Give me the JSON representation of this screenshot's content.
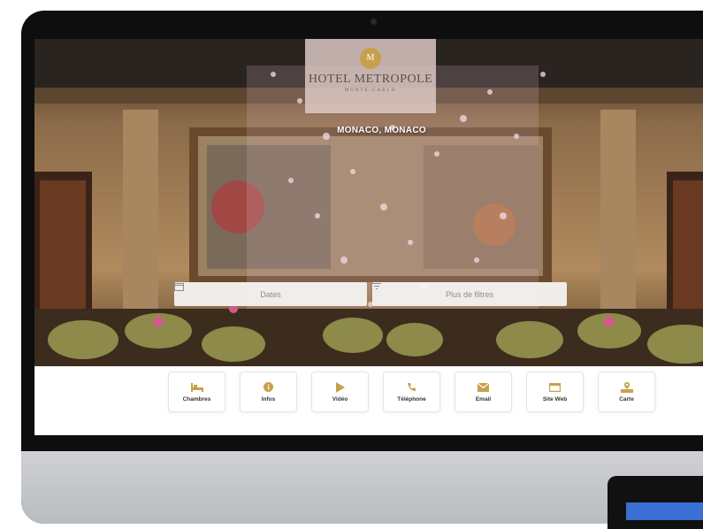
{
  "hotel": {
    "logo_mark": "M",
    "name": "HOTEL METROPOLE",
    "tagline": "MONTE-CARLO",
    "location": "MONACO, MONACO"
  },
  "search": {
    "dates_label": "Dates",
    "filters_label": "Plus de filtres"
  },
  "actions": [
    {
      "label": "Chambres",
      "icon": "bed-icon"
    },
    {
      "label": "Infos",
      "icon": "info-icon"
    },
    {
      "label": "Vidéo",
      "icon": "play-icon"
    },
    {
      "label": "Téléphone",
      "icon": "phone-icon"
    },
    {
      "label": "Email",
      "icon": "email-icon"
    },
    {
      "label": "Site Web",
      "icon": "website-icon"
    },
    {
      "label": "Carte",
      "icon": "map-icon"
    }
  ],
  "colors": {
    "accent_gold": "#c8a04a",
    "bezel": "#0e0e0f"
  }
}
